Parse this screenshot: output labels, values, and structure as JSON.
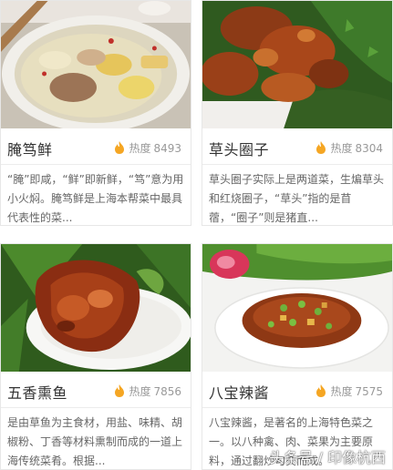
{
  "dishes": [
    {
      "name": "腌笃鲜",
      "heat_label": "热度",
      "heat_value": "8493",
      "description": "“腌”即咸，“鲜”即新鲜，“笃”意为用小火焖。腌笃鲜是上海本帮菜中最具代表性的菜...",
      "image": "soup-bowl-with-pork-and-bamboo"
    },
    {
      "name": "草头圈子",
      "heat_label": "热度",
      "heat_value": "8304",
      "description": "草头圈子实际上是两道菜，生煸草头和红烧圈子，“草头”指的是苜蓿，“圈子”则是猪直...",
      "image": "braised-intestines-with-greens"
    },
    {
      "name": "五香熏鱼",
      "heat_label": "热度",
      "heat_value": "7856",
      "description": "是由草鱼为主食材，用盐、味精、胡椒粉、丁香等材料熏制而成的一道上海传统菜肴。根据...",
      "image": "smoked-fish-on-white-plate"
    },
    {
      "name": "八宝辣酱",
      "heat_label": "热度",
      "heat_value": "7575",
      "description": "八宝辣酱，是著名的上海特色菜之一。以八种禽、肉、菜果为主要原料，通过翻炒勾芡而成。",
      "image": "diced-sauce-dish-with-peas"
    }
  ],
  "watermark": "头条号 / 印像杭西",
  "colors": {
    "flame": "#f5a623",
    "title": "#333333",
    "meta": "#999999",
    "desc": "#666666"
  }
}
